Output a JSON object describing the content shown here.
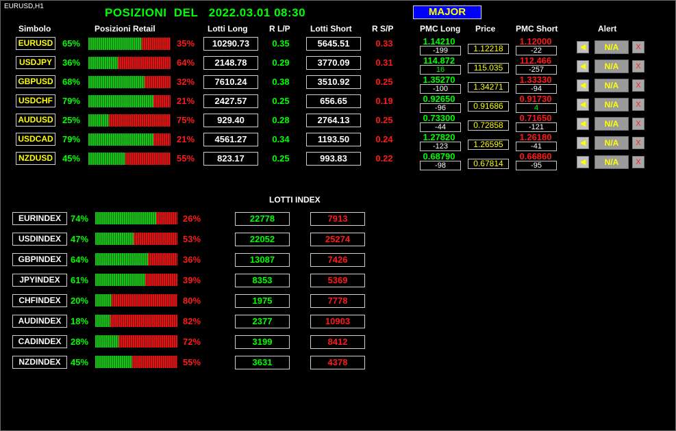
{
  "window_title": "EURUSD,H1",
  "title": "POSIZIONI  DEL   2022.03.01 08:30",
  "major_label": "MAJOR",
  "headers": {
    "symbol": "Simbolo",
    "retail": "Posizioni Retail",
    "lots_long": "Lotti Long",
    "r_lp": "R L/P",
    "lots_short": "Lotti Short",
    "r_sp": "R S/P",
    "pmc_long": "PMC Long",
    "price": "Price",
    "pmc_short": "PMC Short",
    "alert": "Alert"
  },
  "pairs": [
    {
      "symbol": "EURUSD",
      "long_pct": "65%",
      "long_frac": 0.65,
      "short_pct": "35%",
      "lots_long": "10290.73",
      "r_lp": "0.35",
      "lots_short": "5645.51",
      "r_sp": "0.33",
      "pmc_long": "1.14210",
      "pmc_long_diff": "-199",
      "pmc_long_diff_color": "#ffffff",
      "price": "1.12218",
      "pmc_short": "1.12000",
      "pmc_short_diff": "-22",
      "pmc_short_diff_color": "#ffffff",
      "alert_value": "N/A"
    },
    {
      "symbol": "USDJPY",
      "long_pct": "36%",
      "long_frac": 0.36,
      "short_pct": "64%",
      "lots_long": "2148.78",
      "r_lp": "0.29",
      "lots_short": "3770.09",
      "r_sp": "0.31",
      "pmc_long": "114.872",
      "pmc_long_diff": "16",
      "pmc_long_diff_color": "#00ff00",
      "price": "115.035",
      "pmc_short": "112.466",
      "pmc_short_diff": "-257",
      "pmc_short_diff_color": "#ffffff",
      "alert_value": "N/A"
    },
    {
      "symbol": "GBPUSD",
      "long_pct": "68%",
      "long_frac": 0.68,
      "short_pct": "32%",
      "lots_long": "7610.24",
      "r_lp": "0.38",
      "lots_short": "3510.92",
      "r_sp": "0.25",
      "pmc_long": "1.35270",
      "pmc_long_diff": "-100",
      "pmc_long_diff_color": "#ffffff",
      "price": "1.34271",
      "pmc_short": "1.33330",
      "pmc_short_diff": "-94",
      "pmc_short_diff_color": "#ffffff",
      "alert_value": "N/A"
    },
    {
      "symbol": "USDCHF",
      "long_pct": "79%",
      "long_frac": 0.79,
      "short_pct": "21%",
      "lots_long": "2427.57",
      "r_lp": "0.25",
      "lots_short": "656.65",
      "r_sp": "0.19",
      "pmc_long": "0.92650",
      "pmc_long_diff": "-96",
      "pmc_long_diff_color": "#ffffff",
      "price": "0.91686",
      "pmc_short": "0.91730",
      "pmc_short_diff": "4",
      "pmc_short_diff_color": "#00ff00",
      "alert_value": "N/A"
    },
    {
      "symbol": "AUDUSD",
      "long_pct": "25%",
      "long_frac": 0.25,
      "short_pct": "75%",
      "lots_long": "929.40",
      "r_lp": "0.28",
      "lots_short": "2764.13",
      "r_sp": "0.25",
      "pmc_long": "0.73300",
      "pmc_long_diff": "-44",
      "pmc_long_diff_color": "#ffffff",
      "price": "0.72858",
      "pmc_short": "0.71650",
      "pmc_short_diff": "-121",
      "pmc_short_diff_color": "#ffffff",
      "alert_value": "N/A"
    },
    {
      "symbol": "USDCAD",
      "long_pct": "79%",
      "long_frac": 0.79,
      "short_pct": "21%",
      "lots_long": "4561.27",
      "r_lp": "0.34",
      "lots_short": "1193.50",
      "r_sp": "0.24",
      "pmc_long": "1.27820",
      "pmc_long_diff": "-123",
      "pmc_long_diff_color": "#ffffff",
      "price": "1.26595",
      "pmc_short": "1.26180",
      "pmc_short_diff": "-41",
      "pmc_short_diff_color": "#ffffff",
      "alert_value": "N/A"
    },
    {
      "symbol": "NZDUSD",
      "long_pct": "45%",
      "long_frac": 0.45,
      "short_pct": "55%",
      "lots_long": "823.17",
      "r_lp": "0.25",
      "lots_short": "993.83",
      "r_sp": "0.22",
      "pmc_long": "0.68790",
      "pmc_long_diff": "-98",
      "pmc_long_diff_color": "#ffffff",
      "price": "0.67814",
      "pmc_short": "0.66860",
      "pmc_short_diff": "-95",
      "pmc_short_diff_color": "#ffffff",
      "alert_value": "N/A"
    }
  ],
  "alert_icon": "megaphone-icon",
  "remove_label": "X",
  "lotti_index_title": "LOTTI INDEX",
  "indexes": [
    {
      "name": "EURINDEX",
      "long_pct": "74%",
      "long_frac": 0.74,
      "short_pct": "26%",
      "lots_long": "22778",
      "lots_short": "7913"
    },
    {
      "name": "USDINDEX",
      "long_pct": "47%",
      "long_frac": 0.47,
      "short_pct": "53%",
      "lots_long": "22052",
      "lots_short": "25274"
    },
    {
      "name": "GBPINDEX",
      "long_pct": "64%",
      "long_frac": 0.64,
      "short_pct": "36%",
      "lots_long": "13087",
      "lots_short": "7426"
    },
    {
      "name": "JPYINDEX",
      "long_pct": "61%",
      "long_frac": 0.61,
      "short_pct": "39%",
      "lots_long": "8353",
      "lots_short": "5369"
    },
    {
      "name": "CHFINDEX",
      "long_pct": "20%",
      "long_frac": 0.2,
      "short_pct": "80%",
      "lots_long": "1975",
      "lots_short": "7778"
    },
    {
      "name": "AUDINDEX",
      "long_pct": "18%",
      "long_frac": 0.18,
      "short_pct": "82%",
      "lots_long": "2377",
      "lots_short": "10903"
    },
    {
      "name": "CADINDEX",
      "long_pct": "28%",
      "long_frac": 0.28,
      "short_pct": "72%",
      "lots_long": "3199",
      "lots_short": "8412"
    },
    {
      "name": "NZDINDEX",
      "long_pct": "45%",
      "long_frac": 0.45,
      "short_pct": "55%",
      "lots_long": "3631",
      "lots_short": "4378"
    }
  ],
  "colors": {
    "long": "#00ff00",
    "short": "#ff1a1a",
    "accent": "#ffff00",
    "major_bg": "#0000ff"
  }
}
